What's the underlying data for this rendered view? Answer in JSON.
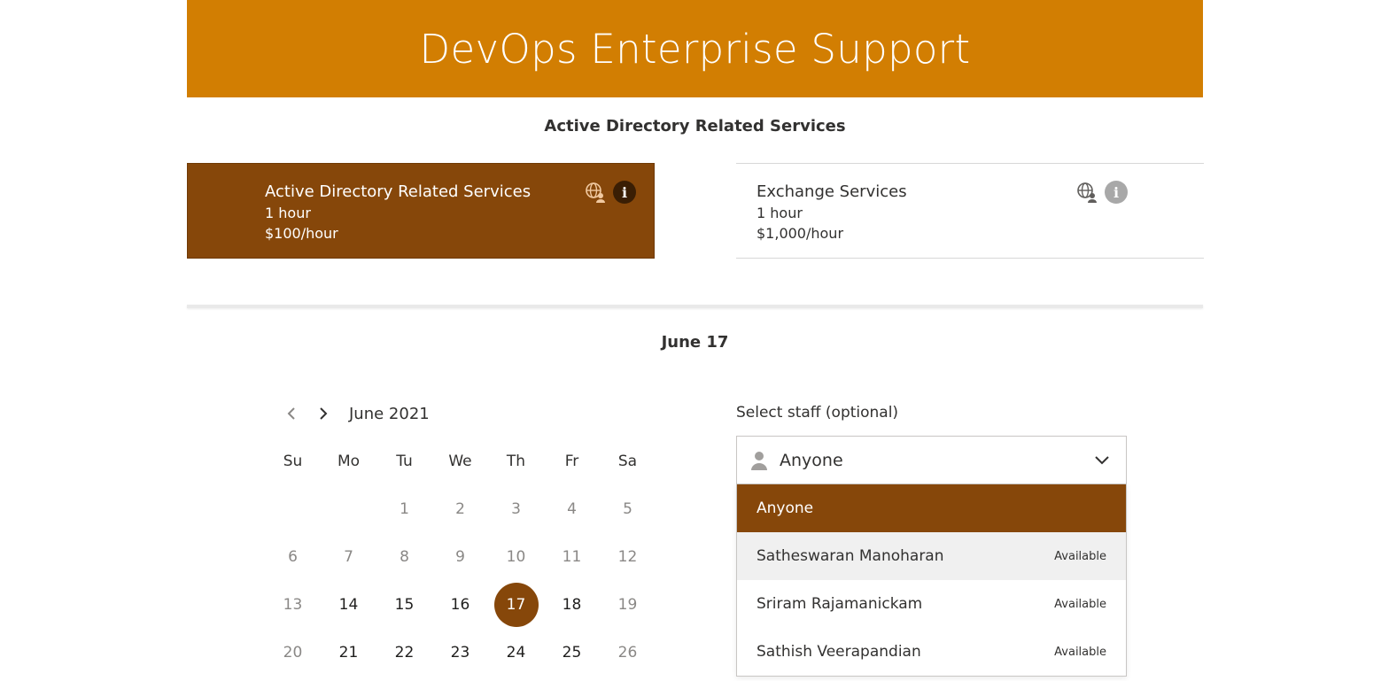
{
  "header": {
    "title": "DevOps Enterprise Support"
  },
  "services": {
    "section_title": "Active Directory Related Services",
    "items": [
      {
        "name": "Active Directory Related Services",
        "duration": "1 hour",
        "price": "$100/hour",
        "selected": true
      },
      {
        "name": "Exchange Services",
        "duration": "1 hour",
        "price": "$1,000/hour",
        "selected": false
      }
    ]
  },
  "date": {
    "title": "June 17",
    "month_label": "June 2021",
    "weekdays": [
      "Su",
      "Mo",
      "Tu",
      "We",
      "Th",
      "Fr",
      "Sa"
    ],
    "weeks": [
      [
        "",
        "",
        "",
        "1",
        "2",
        "3",
        "4",
        "5"
      ],
      [
        "6",
        "7",
        "8",
        "9",
        "10",
        "11",
        "12"
      ],
      [
        "13",
        "14",
        "15",
        "16",
        "17",
        "18",
        "19"
      ],
      [
        "20",
        "21",
        "22",
        "23",
        "24",
        "25",
        "26"
      ]
    ],
    "selected_day": "17"
  },
  "staff": {
    "label": "Select staff (optional)",
    "selected_value": "Anyone",
    "options": [
      {
        "name": "Anyone",
        "status": ""
      },
      {
        "name": "Satheswaran Manoharan",
        "status": "Available"
      },
      {
        "name": "Sriram Rajamanickam",
        "status": "Available"
      },
      {
        "name": "Sathish Veerapandian",
        "status": "Available"
      }
    ]
  },
  "colors": {
    "banner": "#d27e02",
    "accent": "#86470a"
  },
  "icons": {
    "globe": "globe-person-icon",
    "info": "info-icon",
    "person": "person-icon",
    "chevron": "chevron-down-icon",
    "prev": "chevron-left-icon",
    "next": "chevron-right-icon"
  }
}
